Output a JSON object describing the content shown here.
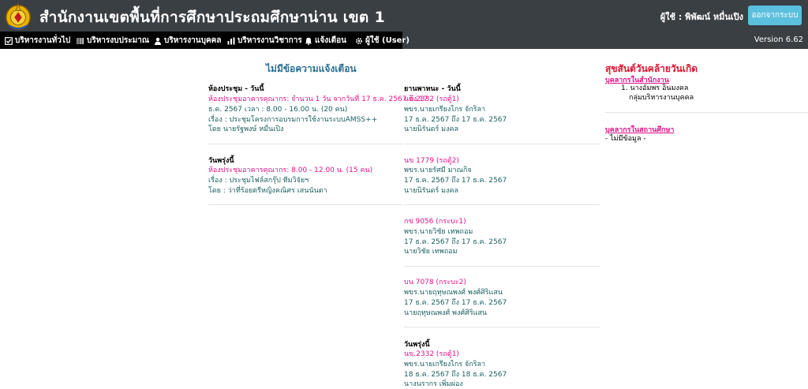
{
  "header": {
    "title": "สำนักงานเขตพื้นที่การศึกษาประถมศึกษาน่าน เขต 1",
    "user_label": "ผู้ใช้ : พิพัฒน์ หมื่นเปิง",
    "logout_label": "ออกจากระบบ"
  },
  "nav": {
    "items": [
      {
        "label": "บริหารงานทั่วไป",
        "icon": "check-square-icon"
      },
      {
        "label": "บริหารงบประมาณ",
        "icon": "barcode-icon"
      },
      {
        "label": "บริหารงานบุคคล",
        "icon": "user-icon"
      },
      {
        "label": "บริหารงานวิชาการ",
        "icon": "bar-chart-icon"
      },
      {
        "label": "แจ้งเตือน",
        "icon": "bell-icon"
      },
      {
        "label": "ผู้ใช้ (User)",
        "icon": "gear-icon"
      }
    ],
    "version": "Version 6.62"
  },
  "alerts": {
    "title": "ไม่มีข้อความแจ้งเตือน"
  },
  "meeting": {
    "today": {
      "heading": "ห้องประชุม - วันนี้",
      "line1": "ห้องประชุมอาคารคุณากร: จำนวน 1 วัน จากวันที่ 17 ธ.ค. 2567 ถึง 17",
      "line2": "ธ.ค. 2567 เวลา : 8.00 - 16.00 น. (20 คน)",
      "line3": "เรื่อง : ประชุมโครงการอบรมการใช้งานระบบAMSS++",
      "line4": "โดย นายรัฐพงษ์  หมื่นเปิง"
    },
    "tomorrow": {
      "heading": "วันพรุ่งนี้",
      "line1": "ห้องประชุมอาคารคุณากร: 8.00 - 12.00 น. (15 คน)",
      "line2": "เรื่อง : ประชุมไฟล์สกรุ๊ป ทีมวิจัยฯ",
      "line3": "โดย : ว่าที่ร้อยตรีหญิงคณิศร  เสนนันตา"
    }
  },
  "vehicles": {
    "heading": "ยานพาหนะ - วันนี้",
    "entries": [
      {
        "plate": "นข.2332 (รถตู้1)",
        "driver": "พขร.นายเกรียงไกร  จักริลา",
        "dates": "17 ธ.ค. 2567 ถึง 17 ธ.ค. 2567",
        "by": "นายนิรันดร์  มงคล"
      },
      {
        "plate": "นข 1779 (รถตู้2)",
        "driver": "พขร.นายรัศมี  มาณกิจ",
        "dates": "17 ธ.ค. 2567 ถึง 17 ธ.ค. 2567",
        "by": "นายนิรันดร์  มงคล"
      },
      {
        "plate": "กข 9056 (กระบะ1)",
        "driver": "พขร.นายวิชัย  เทพถอม",
        "dates": "17 ธ.ค. 2567 ถึง 17 ธ.ค. 2567",
        "by": "นายวิชัย  เทพถอม"
      },
      {
        "plate": "บน 7078 (กระบะ2)",
        "driver": "พขร.นายฤทุษณพงศ์  พงศ์ศิริแสน",
        "dates": "17 ธ.ค. 2567 ถึง 17 ธ.ค. 2567",
        "by": "นายฤทุษณพงศ์  พงศ์ศิริแสน"
      }
    ],
    "tomorrow": {
      "heading": "วันพรุ่งนี้",
      "plate": "นข.2332 (รถตู้1)",
      "driver": "พขร.นายเกรียงไกร  จักริลา",
      "dates": "18 ธ.ค. 2567 ถึง 18 ธ.ค. 2567",
      "by": "นางนรากร  เพิ่มผ่อง"
    }
  },
  "birthday": {
    "title": "สุขสันต์วันคล้ายวันเกิด",
    "office_head": "บุคลากรในสำนักงาน",
    "office_person": "1. นางอัมพร อินมงคล",
    "office_group": "กลุ่มบริหารงานบุคคล",
    "school_head": "บุคลากรในสถานศึกษา",
    "school_none": "- ไม่มีข้อมูล -"
  }
}
